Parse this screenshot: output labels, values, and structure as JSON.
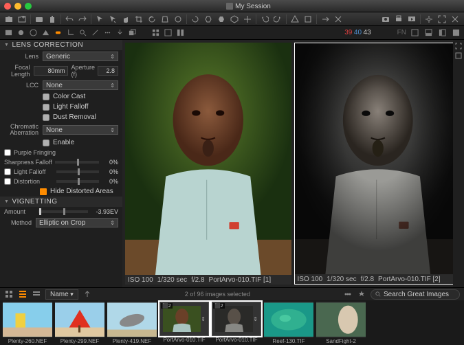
{
  "window": {
    "title": "My Session"
  },
  "counter": {
    "a": "39",
    "b": "40",
    "c": "43",
    "fn": "FN"
  },
  "lens_correction": {
    "title": "LENS CORRECTION",
    "lens_label": "Lens",
    "lens_value": "Generic",
    "focal_label": "Focal Length",
    "focal_value": "80mm",
    "aperture_label": "Aperture (f)",
    "aperture_value": "2.8",
    "lcc_label": "LCC",
    "lcc_value": "None",
    "color_cast": "Color Cast",
    "light_falloff": "Light Falloff",
    "dust_removal": "Dust Removal",
    "chromatic_label": "Chromatic Aberration",
    "chromatic_value": "None",
    "enable": "Enable",
    "purple_fringing": "Purple Fringing",
    "sharpness_falloff": "Sharpness Falloff",
    "sharpness_val": "0%",
    "light_falloff2": "Light Falloff",
    "light_val": "0%",
    "distortion": "Distortion",
    "distortion_val": "0%",
    "hide_distorted": "Hide Distorted Areas"
  },
  "vignetting": {
    "title": "VIGNETTING",
    "amount_label": "Amount",
    "amount_value": "-3.93EV",
    "method_label": "Method",
    "method_value": "Elliptic on Crop"
  },
  "image_info": {
    "iso": "ISO 100",
    "shutter": "1/320 sec",
    "aperture": "f/2.8",
    "name1": "PortArvo-010.TIF [1]",
    "name2": "PortArvo-010.TIF [2]"
  },
  "browser": {
    "sort_label": "Name",
    "count": "2 of 96 images selected",
    "search_placeholder": "Search Great Images",
    "thumbs": [
      {
        "label": "Plenty-260.NEF"
      },
      {
        "label": "Plenty-299.NEF"
      },
      {
        "label": "Plenty-419.NEF"
      },
      {
        "label": "PortArvo-010.TIF",
        "badge": "2",
        "selected": true
      },
      {
        "label": "PortArvo-010.TIF",
        "badge": "2",
        "selected": true
      },
      {
        "label": "Reef-130.TIF"
      },
      {
        "label": "SandFight-2"
      }
    ]
  }
}
